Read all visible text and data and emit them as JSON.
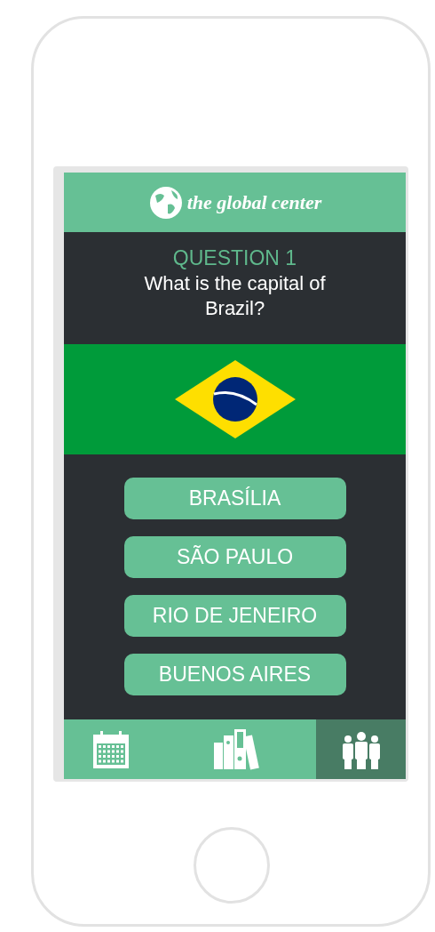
{
  "header": {
    "logo_text": "the global center"
  },
  "question": {
    "label": "QUESTION 1",
    "text": "What is the capital of Brazil?"
  },
  "answers": [
    {
      "label": "BRASÍLIA"
    },
    {
      "label": "SÃO PAULO"
    },
    {
      "label": "RIO DE JENEIRO"
    },
    {
      "label": "BUENOS AIRES"
    }
  ],
  "tabs": [
    {
      "kind": "calendar",
      "selected": false
    },
    {
      "kind": "library",
      "selected": false
    },
    {
      "kind": "people",
      "selected": true
    }
  ]
}
